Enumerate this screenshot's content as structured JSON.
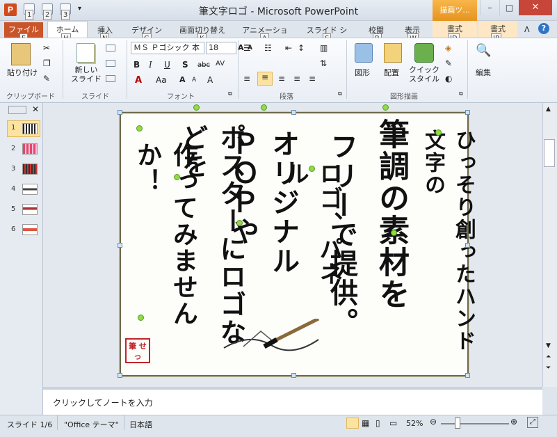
{
  "window": {
    "title": "筆文字ロゴ - Microsoft PowerPoint",
    "context_group": "描画ツ...",
    "min": "–",
    "max": "□",
    "close": "✕"
  },
  "quick_access": {
    "keys": [
      "1",
      "2",
      "3"
    ]
  },
  "tabs": {
    "file": "ファイル",
    "home": "ホーム",
    "insert": "挿入",
    "design": "デザイン",
    "transitions": "画面切り替え",
    "animations": "アニメーション",
    "slideshow": "スライド ショー",
    "review": "校閲",
    "view": "表示",
    "format1": "書式",
    "format2": "書式"
  },
  "keytips": {
    "file": "F",
    "home": "H",
    "insert": "N",
    "design": "G",
    "transitions": "K",
    "animations": "A",
    "slideshow": "S",
    "review": "R",
    "view": "W",
    "format1": "JD",
    "format2": "JP"
  },
  "ribbon": {
    "clipboard": {
      "label": "クリップボード",
      "paste": "貼り付け"
    },
    "slides": {
      "label": "スライド",
      "new_slide": "新しい\nスライド"
    },
    "font": {
      "label": "フォント",
      "name": "ＭＳ Ｐゴシック 本",
      "size": "18",
      "bold": "B",
      "italic": "I",
      "underline": "U",
      "shadow": "S",
      "strike": "abc",
      "spacing": "AV",
      "color": "A",
      "case": "Aa"
    },
    "paragraph": {
      "label": "段落"
    },
    "drawing": {
      "label": "図形描画",
      "shapes": "図形",
      "arrange": "配置",
      "quick_styles": "クイック\nスタイル"
    },
    "editing": {
      "label": "編集",
      "edit": "編集"
    }
  },
  "slides_pane": {
    "numbers": [
      "1",
      "2",
      "3",
      "4",
      "5",
      "6"
    ],
    "selected": "1"
  },
  "slide": {
    "columns": [
      "作ってみませんか！",
      "ポスターにロゴなどを",
      "オリジナルＰＯＰや",
      "ロゴ、パネル",
      "フリーで提供。",
      "筆調の素材を",
      "ひっそり創ったハンド文字の"
    ],
    "stamp": "筆 せっ"
  },
  "notes": {
    "placeholder": "クリックしてノートを入力"
  },
  "status": {
    "slide": "スライド 1/6",
    "theme": "\"Office テーマ\"",
    "language": "日本語",
    "zoom": "52%"
  },
  "colors": {
    "file_tab": "#c9552a",
    "close": "#c7463a",
    "context": "#e6931e",
    "stamp": "#c0232b"
  }
}
